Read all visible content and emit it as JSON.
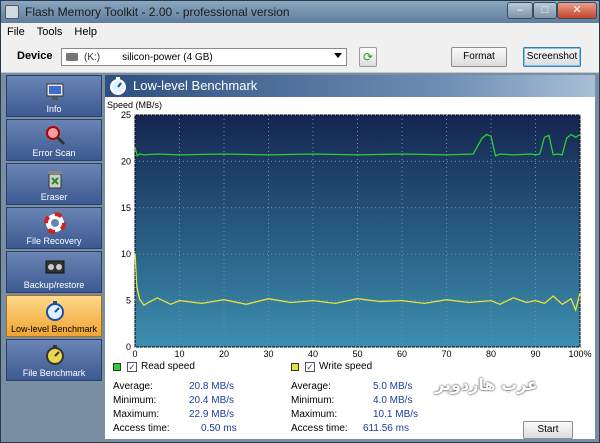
{
  "window": {
    "title": "Flash Memory Toolkit - 2.00 - professional version"
  },
  "menu": [
    "File",
    "Tools",
    "Help"
  ],
  "device": {
    "label": "Device",
    "letter": "(K:)",
    "name": "silicon-power (4 GB)",
    "format_label": "Format",
    "screenshot_label": "Screenshot"
  },
  "sidebar": {
    "items": [
      {
        "label": "Info",
        "icon": "info-icon"
      },
      {
        "label": "Error Scan",
        "icon": "magnifier-icon"
      },
      {
        "label": "Eraser",
        "icon": "trash-icon"
      },
      {
        "label": "File Recovery",
        "icon": "lifebuoy-icon"
      },
      {
        "label": "Backup/restore",
        "icon": "tape-icon"
      },
      {
        "label": "Low-level Benchmark",
        "icon": "stopwatch-icon"
      },
      {
        "label": "File Benchmark",
        "icon": "stopwatch-icon"
      }
    ],
    "active_index": 5
  },
  "header": {
    "title": "Low-level Benchmark"
  },
  "chart_data": {
    "type": "line",
    "ylabel": "Speed (MB/s)",
    "x_ticks": [
      "0",
      "10",
      "20",
      "30",
      "40",
      "50",
      "60",
      "70",
      "80",
      "90",
      "100%"
    ],
    "y_ticks": [
      "0",
      "5",
      "10",
      "15",
      "20",
      "25"
    ],
    "xlim": [
      0,
      100
    ],
    "ylim": [
      0,
      25
    ],
    "series": [
      {
        "name": "Read speed",
        "color": "#2bd12b",
        "x": [
          0,
          0.5,
          1,
          2,
          5,
          10,
          20,
          30,
          40,
          50,
          60,
          70,
          76,
          78,
          79,
          80,
          81,
          82,
          85,
          89,
          90,
          91,
          92,
          93,
          94,
          95,
          96,
          97,
          98,
          99,
          100
        ],
        "y": [
          21.5,
          20.6,
          20.8,
          20.7,
          20.8,
          20.7,
          20.8,
          20.7,
          20.8,
          20.7,
          20.8,
          20.7,
          20.8,
          22.5,
          22.9,
          22.7,
          20.6,
          20.8,
          20.7,
          20.8,
          20.7,
          20.8,
          22.6,
          22.8,
          20.7,
          20.8,
          20.7,
          22.5,
          22.9,
          22.6,
          22.9
        ]
      },
      {
        "name": "Write speed",
        "color": "#e6e23a",
        "x": [
          0,
          0.4,
          1,
          2,
          3,
          5,
          8,
          10,
          15,
          20,
          25,
          30,
          35,
          40,
          45,
          50,
          55,
          60,
          65,
          70,
          75,
          80,
          82,
          85,
          88,
          90,
          92,
          94,
          96,
          98,
          99,
          100
        ],
        "y": [
          10.1,
          6.5,
          5.2,
          4.5,
          4.8,
          5.3,
          4.6,
          5.0,
          4.7,
          5.1,
          4.6,
          5.2,
          4.8,
          5.0,
          4.7,
          5.2,
          4.9,
          5.0,
          4.7,
          5.1,
          4.8,
          5.0,
          4.6,
          5.3,
          4.8,
          5.0,
          4.7,
          5.5,
          4.6,
          5.2,
          4.0,
          5.8
        ]
      }
    ],
    "grid": true,
    "background": "#1b2f55"
  },
  "stats": {
    "read": {
      "legend": "Read speed",
      "average_label": "Average:",
      "average": "20.8 MB/s",
      "minimum_label": "Minimum:",
      "minimum": "20.4 MB/s",
      "maximum_label": "Maximum:",
      "maximum": "22.9 MB/s",
      "access_label": "Access time:",
      "access": "0.50 ms"
    },
    "write": {
      "legend": "Write speed",
      "average_label": "Average:",
      "average": "5.0 MB/s",
      "minimum_label": "Minimum:",
      "minimum": "4.0 MB/s",
      "maximum_label": "Maximum:",
      "maximum": "10.1 MB/s",
      "access_label": "Access time:",
      "access": "611.56 ms"
    }
  },
  "start_label": "Start",
  "watermark": "عرب هاردوير"
}
